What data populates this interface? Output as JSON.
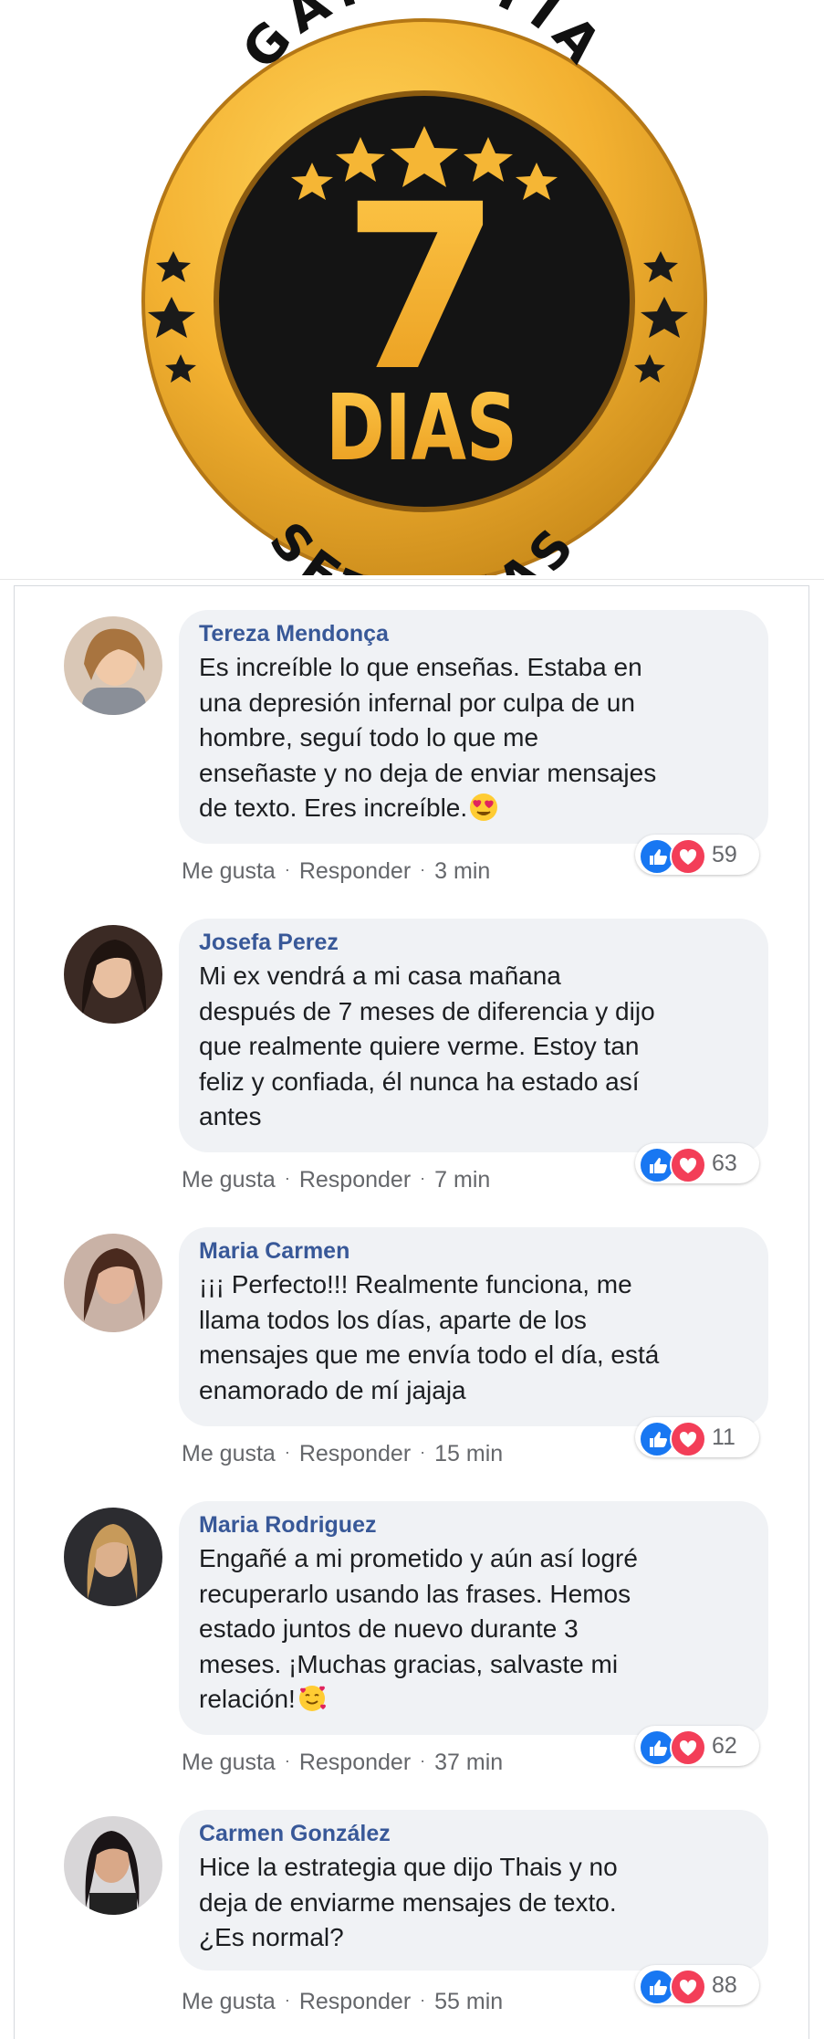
{
  "badge": {
    "arc_top": "GARANTIA",
    "number": "7",
    "word": "DIAS",
    "arc_bottom": "SETE DIAS",
    "colors": {
      "gold": "#f3b131",
      "gold_dark": "#c98a1a",
      "inner": "#141414",
      "star": "#1a1a1a"
    }
  },
  "actions": {
    "like": "Me gusta",
    "reply": "Responder"
  },
  "comments": [
    {
      "author": "Tereza Mendonça",
      "lines": [
        "Es increíble lo que enseñas. Estaba en",
        "una depresión infernal por culpa de un",
        "hombre, seguí todo lo que me",
        "enseñaste y no deja de enviar mensajes",
        "de texto. Eres increíble."
      ],
      "emoji": "heart-eyes",
      "reactions": "59",
      "time": "3 min"
    },
    {
      "author": "Josefa Perez",
      "lines": [
        "Mi ex vendrá a mi casa mañana",
        "después de 7 meses de diferencia y dijo",
        "que realmente quiere verme. Estoy tan",
        "feliz y confiada, él nunca ha estado así",
        "antes"
      ],
      "emoji": "",
      "reactions": "63",
      "time": "7 min"
    },
    {
      "author": "Maria Carmen",
      "lines": [
        "¡¡¡ Perfecto!!! Realmente funciona, me",
        "llama todos los días, aparte de los",
        "mensajes que me envía todo el día, está",
        "enamorado de mí jajaja"
      ],
      "emoji": "",
      "reactions": "11",
      "time": "15 min"
    },
    {
      "author": "Maria Rodriguez",
      "lines": [
        "Engañé a mi prometido y aún así logré",
        "recuperarlo usando las frases. Hemos",
        "estado juntos de nuevo durante 3",
        "meses. ¡Muchas gracias, salvaste mi",
        "relación!"
      ],
      "emoji": "smiling-hearts",
      "reactions": "62",
      "time": "37 min"
    },
    {
      "author": "Carmen González",
      "lines": [
        "Hice la estrategia que dijo Thais y no",
        "deja de enviarme mensajes de texto.",
        "¿Es normal?"
      ],
      "emoji": "",
      "reactions": "88",
      "time": "55 min"
    }
  ]
}
